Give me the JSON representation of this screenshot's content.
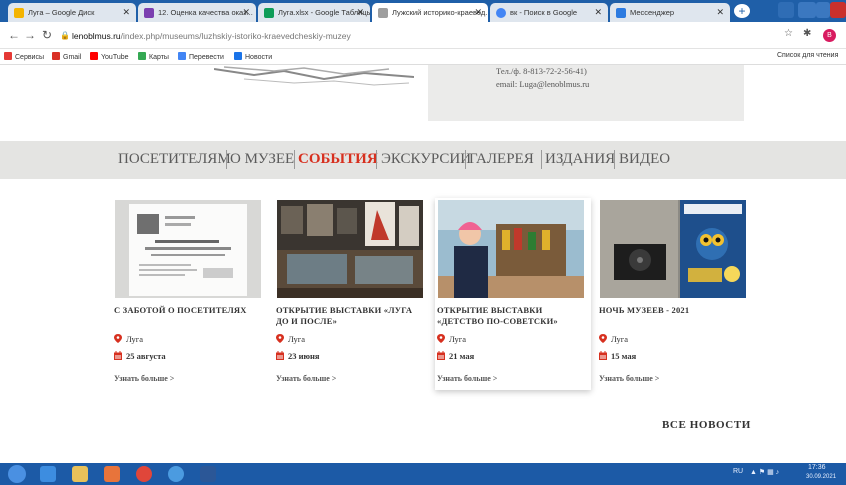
{
  "browser": {
    "tabs": [
      {
        "label": "Луга – Google Диск",
        "fav_color": "#f4b400"
      },
      {
        "label": "12. Оценка качества оказ...",
        "fav_color": "#7b3fb0"
      },
      {
        "label": "Луга.xlsx - Google Таблицы",
        "fav_color": "#0f9d58"
      },
      {
        "label": "Лужский историко-краевед...",
        "fav_color": "#9e9e9e"
      },
      {
        "label": "вк - Поиск в Google",
        "fav_color": "#4285f4"
      },
      {
        "label": "Мессенджер",
        "fav_color": "#2d7be0"
      }
    ],
    "url_host": "lenoblmus.ru",
    "url_path": "/index.php/museums/luzhskiy-istoriko-kraevedcheskiy-muzey",
    "profile_initial": "B",
    "bookmarks": [
      {
        "label": "Сервисы",
        "color": "#e53935"
      },
      {
        "label": "Gmail",
        "color": "#d93025"
      },
      {
        "label": "YouTube",
        "color": "#ff0000"
      },
      {
        "label": "Карты",
        "color": "#34a853"
      },
      {
        "label": "Перевести",
        "color": "#4285f4"
      },
      {
        "label": "Новости",
        "color": "#1a73e8"
      }
    ],
    "reading_list": "Список для чтения"
  },
  "contact": {
    "phone": "Тел./ф. 8-813-72-2-56-41)",
    "email": "email: Luga@lenoblmus.ru"
  },
  "menu": {
    "items": [
      {
        "label": "ПОСЕТИТЕЛЯМ"
      },
      {
        "label": "О МУЗЕЕ"
      },
      {
        "label": "СОБЫТИЯ"
      },
      {
        "label": "ЭКСКУРСИИ"
      },
      {
        "label": "ГАЛЕРЕЯ"
      },
      {
        "label": "ИЗДАНИЯ"
      },
      {
        "label": "ВИДЕО"
      }
    ],
    "active": "СОБЫТИЯ"
  },
  "news": [
    {
      "title": "С ЗАБОТОЙ О ПОСЕТИТЕЛЯХ",
      "city": "Луга",
      "date": "25 августа",
      "more": "Узнать больше >"
    },
    {
      "title": "ОТКРЫТИЕ ВЫСТАВКИ «ЛУГА ДО И ПОСЛЕ»",
      "city": "Луга",
      "date": "23 июня",
      "more": "Узнать больше >"
    },
    {
      "title": "ОТКРЫТИЕ ВЫСТАВКИ «ДЕТСТВО ПО-СОВЕТСКИ»",
      "city": "Луга",
      "date": "21 мая",
      "more": "Узнать больше >"
    },
    {
      "title": "НОЧЬ МУЗЕЕВ - 2021",
      "city": "Луга",
      "date": "15 мая",
      "more": "Узнать больше >"
    }
  ],
  "all_news": "ВСЕ НОВОСТИ",
  "accent_color": "#d7301f",
  "taskbar": {
    "lang": "RU",
    "time": "17:36",
    "date": "30.09.2021"
  }
}
